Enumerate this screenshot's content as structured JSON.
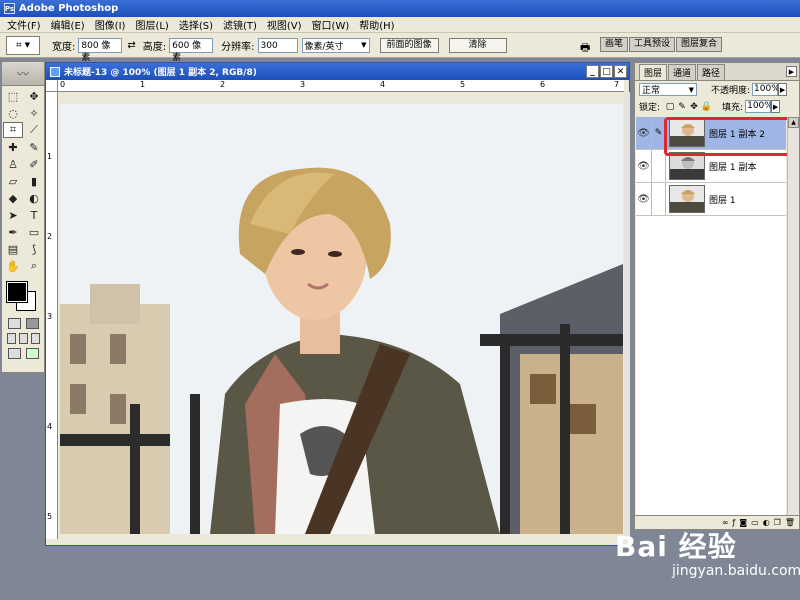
{
  "app": {
    "title": "Adobe Photoshop"
  },
  "menu": [
    "文件(F)",
    "编辑(E)",
    "图像(I)",
    "图层(L)",
    "选择(S)",
    "滤镜(T)",
    "视图(V)",
    "窗口(W)",
    "帮助(H)"
  ],
  "options": {
    "width_label": "宽度:",
    "width_value": "800 像素",
    "height_label": "高度:",
    "height_value": "600 像素",
    "res_label": "分辨率:",
    "res_value": "300",
    "res_unit": "像素/英寸",
    "front_image_btn": "前面的图像",
    "clear_btn": "清除",
    "tabs": [
      "画笔",
      "工具预设",
      "图层复合"
    ]
  },
  "document": {
    "title": "未标题-13 @ 100% (图层 1 副本 2, RGB/8)",
    "ruler_h": [
      "0",
      "1",
      "2",
      "3",
      "4",
      "5",
      "6",
      "7"
    ],
    "ruler_v": [
      "1",
      "2",
      "3",
      "4",
      "5"
    ]
  },
  "layers_panel": {
    "tabs": [
      "图层",
      "通道",
      "路径"
    ],
    "blend_mode": "正常",
    "opacity_label": "不透明度:",
    "opacity_value": "100%",
    "lock_label": "锁定:",
    "fill_label": "填充:",
    "fill_value": "100%",
    "layers": [
      {
        "name": "图层 1 副本 2",
        "selected": true
      },
      {
        "name": "图层 1 副本",
        "selected": false
      },
      {
        "name": "图层 1",
        "selected": false
      }
    ]
  },
  "watermark": {
    "logo": "Bai 经验",
    "url": "jingyan.baidu.com"
  },
  "colors": {
    "title_blue": "#1e4fb8",
    "selection_blue": "#9fb5e6",
    "highlight_red": "#e0262f"
  }
}
